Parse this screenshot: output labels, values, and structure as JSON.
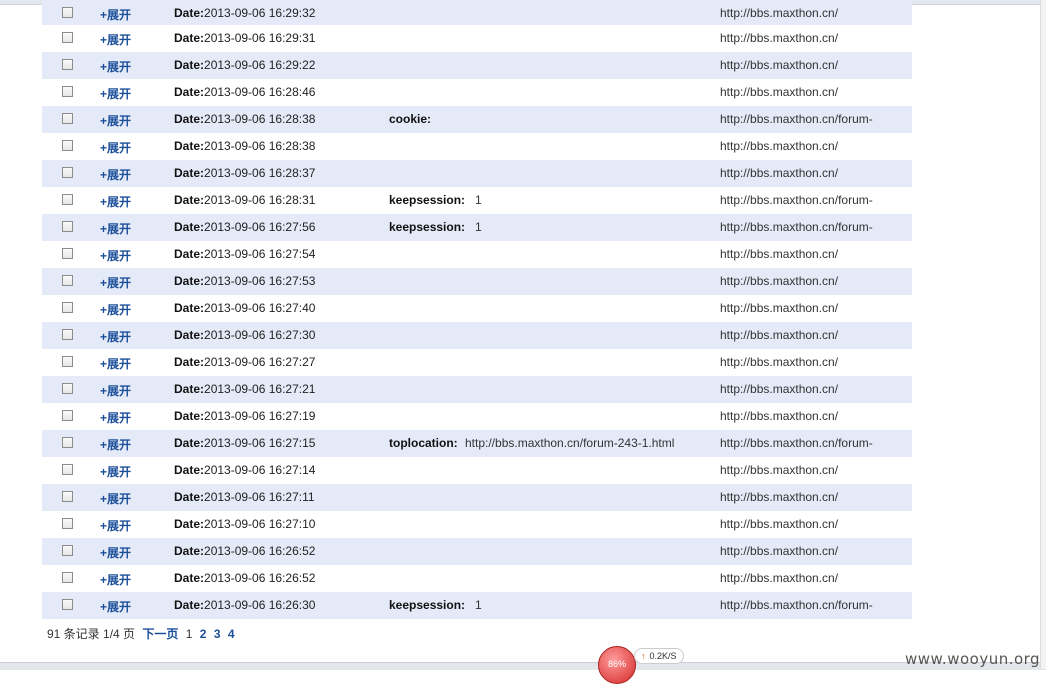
{
  "expand_label": "+展开",
  "date_label": "Date:",
  "rows": [
    {
      "date": "2013-09-06 16:29:32",
      "key": "",
      "value": "",
      "url": "http://bbs.maxthon.cn/"
    },
    {
      "date": "2013-09-06 16:29:31",
      "key": "",
      "value": "",
      "url": "http://bbs.maxthon.cn/"
    },
    {
      "date": "2013-09-06 16:29:22",
      "key": "",
      "value": "",
      "url": "http://bbs.maxthon.cn/"
    },
    {
      "date": "2013-09-06 16:28:46",
      "key": "",
      "value": "",
      "url": "http://bbs.maxthon.cn/"
    },
    {
      "date": "2013-09-06 16:28:38",
      "key": "cookie:",
      "value": "",
      "url": "http://bbs.maxthon.cn/forum-"
    },
    {
      "date": "2013-09-06 16:28:38",
      "key": "",
      "value": "",
      "url": "http://bbs.maxthon.cn/"
    },
    {
      "date": "2013-09-06 16:28:37",
      "key": "",
      "value": "",
      "url": "http://bbs.maxthon.cn/"
    },
    {
      "date": "2013-09-06 16:28:31",
      "key": "keepsession:",
      "value": "1",
      "url": "http://bbs.maxthon.cn/forum-"
    },
    {
      "date": "2013-09-06 16:27:56",
      "key": "keepsession:",
      "value": "1",
      "url": "http://bbs.maxthon.cn/forum-"
    },
    {
      "date": "2013-09-06 16:27:54",
      "key": "",
      "value": "",
      "url": "http://bbs.maxthon.cn/"
    },
    {
      "date": "2013-09-06 16:27:53",
      "key": "",
      "value": "",
      "url": "http://bbs.maxthon.cn/"
    },
    {
      "date": "2013-09-06 16:27:40",
      "key": "",
      "value": "",
      "url": "http://bbs.maxthon.cn/"
    },
    {
      "date": "2013-09-06 16:27:30",
      "key": "",
      "value": "",
      "url": "http://bbs.maxthon.cn/"
    },
    {
      "date": "2013-09-06 16:27:27",
      "key": "",
      "value": "",
      "url": "http://bbs.maxthon.cn/"
    },
    {
      "date": "2013-09-06 16:27:21",
      "key": "",
      "value": "",
      "url": "http://bbs.maxthon.cn/"
    },
    {
      "date": "2013-09-06 16:27:19",
      "key": "",
      "value": "",
      "url": "http://bbs.maxthon.cn/"
    },
    {
      "date": "2013-09-06 16:27:15",
      "key": "toplocation:",
      "value": "http://bbs.maxthon.cn/forum-243-1.html",
      "url": "http://bbs.maxthon.cn/forum-"
    },
    {
      "date": "2013-09-06 16:27:14",
      "key": "",
      "value": "",
      "url": "http://bbs.maxthon.cn/"
    },
    {
      "date": "2013-09-06 16:27:11",
      "key": "",
      "value": "",
      "url": "http://bbs.maxthon.cn/"
    },
    {
      "date": "2013-09-06 16:27:10",
      "key": "",
      "value": "",
      "url": "http://bbs.maxthon.cn/"
    },
    {
      "date": "2013-09-06 16:26:52",
      "key": "",
      "value": "",
      "url": "http://bbs.maxthon.cn/"
    },
    {
      "date": "2013-09-06 16:26:52",
      "key": "",
      "value": "",
      "url": "http://bbs.maxthon.cn/"
    },
    {
      "date": "2013-09-06 16:26:30",
      "key": "keepsession:",
      "value": "1",
      "url": "http://bbs.maxthon.cn/forum-"
    }
  ],
  "pager": {
    "summary": "91 条记录 1/4 页",
    "next_label": "下一页",
    "pages": [
      "1",
      "2",
      "3",
      "4"
    ],
    "current_page": "1"
  },
  "status": {
    "gauge_text": "86%",
    "speed_text": "0.2K/S",
    "up_arrow": "↑"
  },
  "watermark": "www.wooyun.org",
  "colors": {
    "shade": "#e4eaf7",
    "link": "#1c4f9a"
  }
}
